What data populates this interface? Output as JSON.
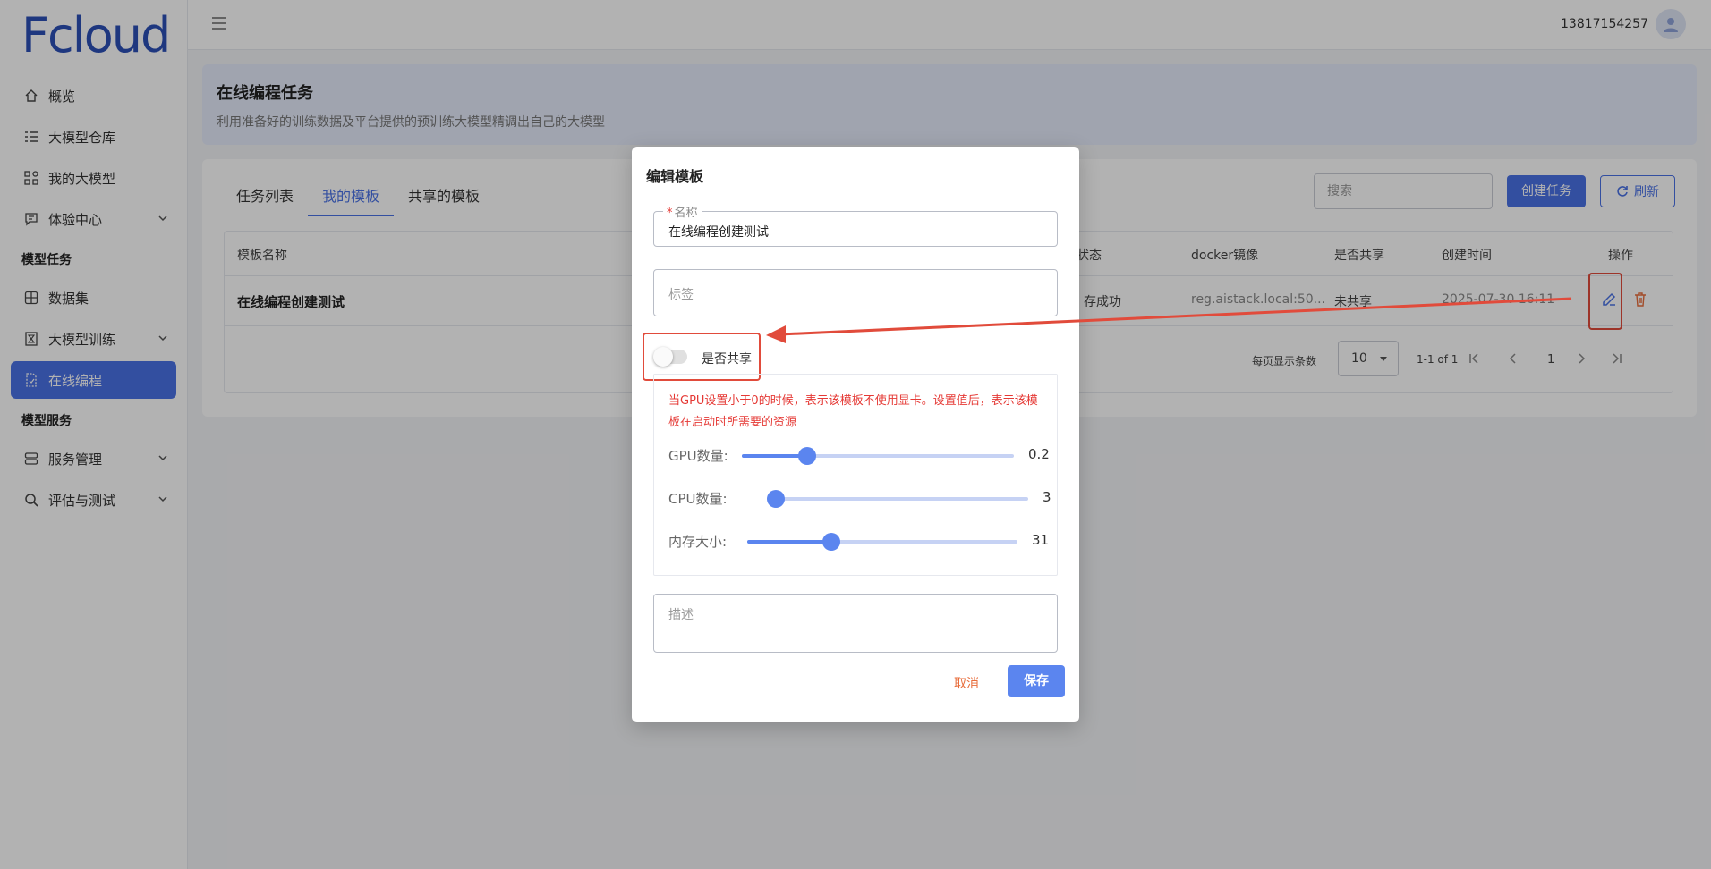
{
  "brand": {
    "logo_text": "Fcloud"
  },
  "header": {
    "user_phone": "13817154257"
  },
  "sidebar": {
    "items": [
      {
        "label": "概览",
        "icon": "home-icon"
      },
      {
        "label": "大模型仓库",
        "icon": "list-icon"
      },
      {
        "label": "我的大模型",
        "icon": "widgets-icon"
      },
      {
        "label": "体验中心",
        "icon": "chat-icon",
        "expandable": true
      }
    ],
    "group_tasks": "模型任务",
    "task_items": [
      {
        "label": "数据集",
        "icon": "grid-icon"
      },
      {
        "label": "大模型训练",
        "icon": "hourglass-icon",
        "expandable": true
      },
      {
        "label": "在线编程",
        "icon": "code-file-icon",
        "active": true
      }
    ],
    "group_services": "模型服务",
    "service_items": [
      {
        "label": "服务管理",
        "icon": "server-icon",
        "expandable": true
      },
      {
        "label": "评估与测试",
        "icon": "search-icon",
        "expandable": true
      }
    ]
  },
  "banner": {
    "title": "在线编程任务",
    "subtitle": "利用准备好的训练数据及平台提供的预训练大模型精调出自己的大模型"
  },
  "tabs": [
    {
      "label": "任务列表"
    },
    {
      "label": "我的模板",
      "active": true
    },
    {
      "label": "共享的模板"
    }
  ],
  "toolbar": {
    "search_placeholder": "搜索",
    "create_label": "创建任务",
    "refresh_label": "刷新"
  },
  "table": {
    "headers": [
      "模板名称",
      "状态",
      "docker镜像",
      "是否共享",
      "创建时间",
      "操作"
    ],
    "rows": [
      {
        "name": "在线编程创建测试",
        "status": "存成功",
        "image": "reg.aistack.local:50...",
        "shared": "未共享",
        "created": "2025-07-30 16:11"
      }
    ]
  },
  "pagination": {
    "rows_per_page_label": "每页显示条数",
    "rows_per_page": "10",
    "range": "1-1 of 1",
    "current_page": "1"
  },
  "modal": {
    "title": "编辑模板",
    "name_label": "名称",
    "name_value": "在线编程创建测试",
    "tags_placeholder": "标签",
    "share_label": "是否共享",
    "share_on": false,
    "resource_note": "当GPU设置小于0的时候，表示该模板不使用显卡。设置值后，表示该模板在启动时所需要的资源",
    "sliders": [
      {
        "label": "GPU数量:",
        "value": "0.2",
        "fraction": 0.24
      },
      {
        "label": "CPU数量:",
        "value": "3",
        "fraction": 0.0
      },
      {
        "label": "内存大小:",
        "value": "31",
        "fraction": 0.31
      }
    ],
    "desc_placeholder": "描述",
    "cancel_label": "取消",
    "save_label": "保存"
  },
  "colors": {
    "primary": "#4a72e6",
    "slider": "#5b85ef",
    "annotation_red": "#e14b3b",
    "note_red": "#e53935"
  }
}
